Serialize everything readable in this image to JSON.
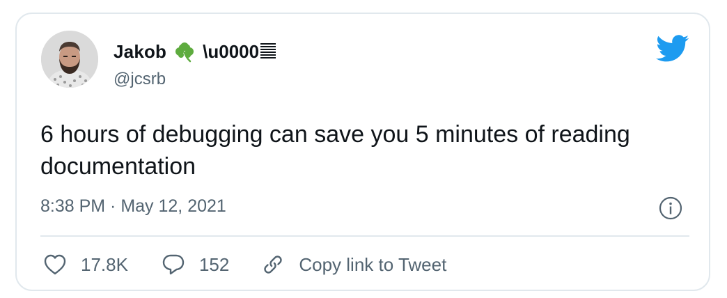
{
  "tweet": {
    "author": {
      "display_name": "Jakob",
      "name_emoji": "shamrock-icon",
      "name_suffix": "\\u0000",
      "handle": "@jcsrb"
    },
    "text": "6 hours of debugging can save you 5 minutes of reading documentation",
    "timestamp": "8:38 PM · May 12, 2021",
    "actions": {
      "like_count": "17.8K",
      "reply_count": "152",
      "copy_link_label": "Copy link to Tweet"
    }
  },
  "icons": {
    "brand": "twitter-bird-icon",
    "info": "info-icon",
    "like": "heart-icon",
    "reply": "speech-bubble-icon",
    "copy_link": "link-icon"
  },
  "colors": {
    "brand": "#1d9bf0",
    "text_primary": "#0f1419",
    "text_secondary": "#536471",
    "border": "#e1e8ed",
    "emoji_green": "#5eab3f"
  }
}
